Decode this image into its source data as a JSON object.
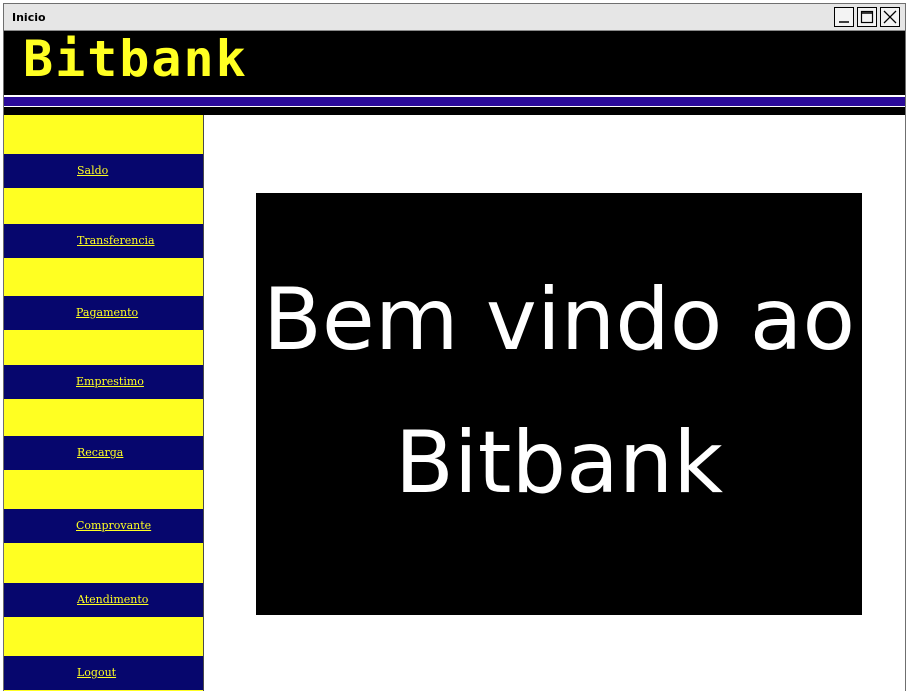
{
  "window": {
    "title": "Inicio"
  },
  "header": {
    "logo_text": "Bitbank"
  },
  "sidebar": {
    "items": [
      {
        "label": "Saldo"
      },
      {
        "label": "Transferencia"
      },
      {
        "label": "Pagamento"
      },
      {
        "label": "Emprestimo"
      },
      {
        "label": "Recarga"
      },
      {
        "label": "Comprovante"
      },
      {
        "label": "Atendimento"
      },
      {
        "label": "Logout"
      }
    ]
  },
  "main": {
    "welcome_line1": "Bem vindo ao",
    "welcome_line2": "Bitbank"
  },
  "colors": {
    "yellow": "#ffff22",
    "navy": "#06066d",
    "purple": "#2a0a9a",
    "black": "#000000"
  }
}
